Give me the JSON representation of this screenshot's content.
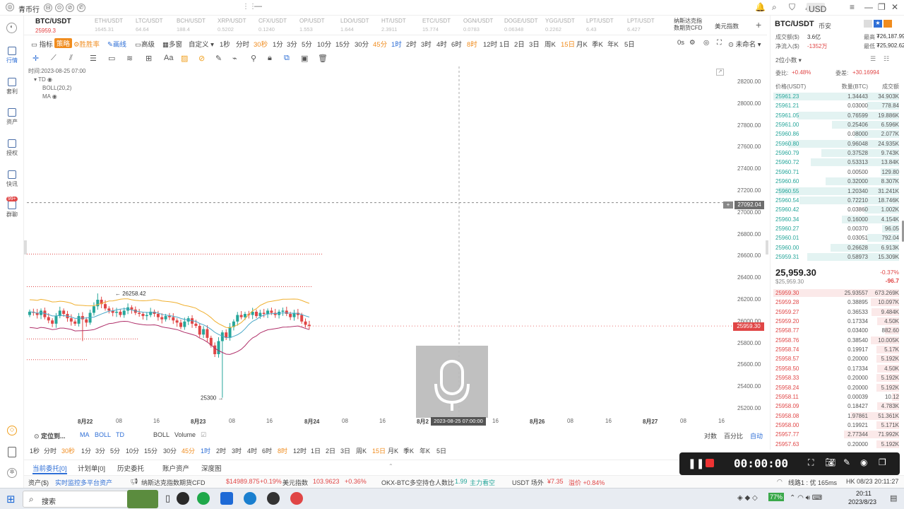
{
  "window": {
    "app_name": "青币行",
    "currency_select": "USD"
  },
  "sidebar": [
    {
      "label": "行情",
      "icon": "chart-icon",
      "active": true
    },
    {
      "label": "套利",
      "icon": "arbitrage-icon"
    },
    {
      "label": "资产",
      "icon": "wallet-icon"
    },
    {
      "label": "授权",
      "icon": "key-icon"
    },
    {
      "label": "快讯",
      "icon": "news-icon"
    },
    {
      "label": "群聊",
      "icon": "chat-icon",
      "badge": "99+"
    }
  ],
  "tickers": [
    {
      "name": "BTC/USDT",
      "price": "25959.3",
      "main": true
    },
    {
      "name": "ETH/USDT",
      "price": "1645.31"
    },
    {
      "name": "LTC/USDT",
      "price": "64.64"
    },
    {
      "name": "BCH/USDT",
      "price": "188.4"
    },
    {
      "name": "XRP/USDT",
      "price": "0.5202"
    },
    {
      "name": "CFX/USDT",
      "price": "0.1240"
    },
    {
      "name": "OP/USDT",
      "price": "1.553"
    },
    {
      "name": "LDO/USDT",
      "price": "1.644"
    },
    {
      "name": "HT/USDT",
      "price": "2.3911"
    },
    {
      "name": "ETC/USDT",
      "price": "15.774"
    },
    {
      "name": "OGN/USDT",
      "price": "0.0783"
    },
    {
      "name": "DOGE/USDT",
      "price": "0.06348"
    },
    {
      "name": "YGG/USDT",
      "price": "0.2262"
    },
    {
      "name": "LPT/USDT",
      "price": "6.43"
    },
    {
      "name": "LPT/USDT",
      "price": "6.427"
    }
  ],
  "tickers_extra": {
    "line1": "纳斯达克指",
    "line2": "数期货CFD",
    "index_label": "美元指数"
  },
  "toolbar1": {
    "indicator": "指标",
    "strategy_btn": "策略",
    "win_rate": "胜胜率",
    "draw": "画线",
    "advanced": "高级",
    "multi": "多窗",
    "custom": "自定义",
    "periods": [
      "1秒",
      "分时",
      "30秒",
      "1分",
      "3分",
      "5分",
      "10分",
      "15分",
      "30分",
      "45分",
      "1时",
      "2时",
      "3时",
      "4时",
      "6时",
      "8时",
      "12时",
      "1日",
      "2日",
      "3日",
      "周K",
      "15日",
      "月K",
      "季K",
      "年K",
      "5日"
    ],
    "zero_s": "0s",
    "unnamed": "未命名"
  },
  "legend": {
    "time": "时间:2023-08-25 07:00",
    "td": "TD",
    "boll": "BOLL(20,2)",
    "ma": "MA"
  },
  "chart_labels": {
    "high_label": "26258.42",
    "low_label": "25300",
    "crosshair_price": "27092.04",
    "last_price": "25959.30",
    "crosshair_time": "2023-08-25 07:00:00"
  },
  "price_axis": [
    "28200.00",
    "28000.00",
    "27800.00",
    "27600.00",
    "27400.00",
    "27200.00",
    "27000.00",
    "26800.00",
    "26600.00",
    "26400.00",
    "26200.00",
    "26000.00",
    "25800.00",
    "25600.00",
    "25400.00",
    "25200.00"
  ],
  "time_axis": [
    "8月22",
    "08",
    "16",
    "8月23",
    "08",
    "16",
    "8月24",
    "08",
    "16",
    "8月2",
    "16",
    "8月26",
    "08",
    "16",
    "8月27",
    "08",
    "16"
  ],
  "bottom_indicator_bar": {
    "locate": "定位到...",
    "ma": "MA",
    "boll": "BOLL",
    "td": "TD",
    "boll2": "BOLL",
    "volume": "Volume",
    "log": "对数",
    "percent": "百分比",
    "auto": "自动"
  },
  "bottom_periods": [
    "1秒",
    "分时",
    "30秒",
    "1分",
    "3分",
    "5分",
    "10分",
    "15分",
    "30分",
    "45分",
    "1时",
    "2时",
    "3时",
    "4时",
    "6时",
    "8时",
    "12时",
    "1日",
    "2日",
    "3日",
    "周K",
    "15日",
    "月K",
    "季K",
    "年K",
    "5日"
  ],
  "bottom_tabs": [
    "当前委托[0]",
    "计划单[0]",
    "历史委托",
    "账户资产",
    "深度图"
  ],
  "right_panel": {
    "symbol": "BTC/USDT",
    "market": "币安",
    "volume_label": "成交额($)",
    "volume_value": "3.6亿",
    "high_label": "最高",
    "high_value": "₮26,187.99",
    "net_label": "净流入($)",
    "net_value": "-1352万",
    "low_label": "最低",
    "low_value": "₮25,902.62",
    "depth_select": "2位小数",
    "ratio_label": "委比:",
    "ratio_value": "+0.48%",
    "diff_label": "委差:",
    "diff_value": "+30.16994",
    "headers": [
      "价格(USDT)",
      "数量(BTC)",
      "成交额"
    ],
    "asks": [
      [
        "25961.23",
        "1.34443",
        "34.903K"
      ],
      [
        "25961.21",
        "0.03000",
        "778.84"
      ],
      [
        "25961.05",
        "0.76599",
        "19.886K"
      ],
      [
        "25961.00",
        "0.25406",
        "6.596K"
      ],
      [
        "25960.86",
        "0.08000",
        "2.077K"
      ],
      [
        "25960.80",
        "0.96048",
        "24.935K"
      ],
      [
        "25960.79",
        "0.37528",
        "9.743K"
      ],
      [
        "25960.72",
        "0.53313",
        "13.84K"
      ],
      [
        "25960.71",
        "0.00500",
        "129.80"
      ],
      [
        "25960.60",
        "0.32000",
        "8.307K"
      ],
      [
        "25960.55",
        "1.20340",
        "31.241K"
      ],
      [
        "25960.54",
        "0.72210",
        "18.746K"
      ],
      [
        "25960.42",
        "0.03860",
        "1.002K"
      ],
      [
        "25960.34",
        "0.16000",
        "4.154K"
      ],
      [
        "25960.27",
        "0.00370",
        "96.05"
      ],
      [
        "25960.01",
        "0.03051",
        "792.04"
      ],
      [
        "25960.00",
        "0.26628",
        "6.913K"
      ],
      [
        "25959.31",
        "0.58973",
        "15.309K"
      ]
    ],
    "last_price": "25,959.30",
    "last_price_sub": "$25,959.30",
    "change_pct": "-0.37%",
    "change_abs": "-96.7",
    "bids": [
      [
        "25959.30",
        "25.93557",
        "673.269K"
      ],
      [
        "25959.28",
        "0.38895",
        "10.097K"
      ],
      [
        "25959.27",
        "0.36533",
        "9.484K"
      ],
      [
        "25959.20",
        "0.17334",
        "4.50K"
      ],
      [
        "25958.77",
        "0.03400",
        "882.60"
      ],
      [
        "25958.76",
        "0.38540",
        "10.005K"
      ],
      [
        "25958.74",
        "0.19917",
        "5.17K"
      ],
      [
        "25958.57",
        "0.20000",
        "5.192K"
      ],
      [
        "25958.50",
        "0.17334",
        "4.50K"
      ],
      [
        "25958.33",
        "0.20000",
        "5.192K"
      ],
      [
        "25958.24",
        "0.20000",
        "5.192K"
      ],
      [
        "25958.11",
        "0.00039",
        "10.12"
      ],
      [
        "25958.09",
        "0.18427",
        "4.783K"
      ],
      [
        "25958.08",
        "1.97861",
        "51.361K"
      ],
      [
        "25958.00",
        "0.19921",
        "5.171K"
      ],
      [
        "25957.77",
        "2.77344",
        "71.992K"
      ],
      [
        "25957.63",
        "0.20000",
        "5.192K"
      ]
    ]
  },
  "status_bar": {
    "assets": "资产($)",
    "monitor": "实时监控多平台资产",
    "nasdaq_label": "纳斯达克指数期货CFD",
    "nasdaq_value": "$14989.875",
    "nasdaq_change": "+0.19%",
    "dxy_label": "美元指数",
    "dxy_value": "103.9623",
    "dxy_change": "+0.36%",
    "okx_label": "OKX-BTC多空持仓人数比",
    "okx_value": "1.99",
    "okx_note": "主力看空",
    "usdt_label": "USDT 场外",
    "usdt_value": "¥7.35",
    "usdt_change": "溢价 +0.84%",
    "line_label": "线路1 : 优 165ms",
    "hk_time": "HK 08/23 20:11:27"
  },
  "recorder": {
    "time": "00:00:00"
  },
  "taskbar": {
    "search": "搜索",
    "battery": "77%",
    "time": "20:11",
    "date": "2023/8/23"
  },
  "colors": {
    "up": "#26a69a",
    "down": "#e04646",
    "orange": "#f08c1e",
    "blue": "#2f6fd6"
  }
}
